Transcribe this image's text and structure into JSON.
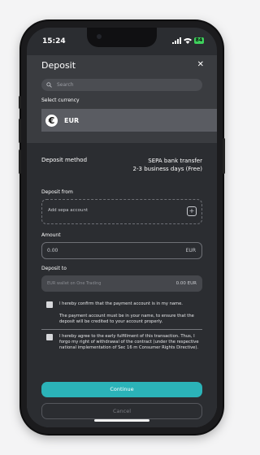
{
  "status": {
    "time": "15:24",
    "battery": "84"
  },
  "header": {
    "title": "Deposit",
    "close_label": "✕"
  },
  "search": {
    "placeholder": "Search"
  },
  "currency": {
    "section_label": "Select currency",
    "symbol": "€",
    "code": "EUR"
  },
  "method": {
    "label": "Deposit method",
    "value_line1": "SEPA bank transfer",
    "value_line2": "2-3 business days (Free)"
  },
  "deposit_from": {
    "label": "Deposit from",
    "placeholder": "Add sepa account"
  },
  "amount": {
    "label": "Amount",
    "value": "0.00",
    "unit": "EUR"
  },
  "deposit_to": {
    "label": "Deposit to",
    "placeholder": "EUR wallet on One Trading",
    "amount": "0.00 EUR"
  },
  "confirm": {
    "text1": "I hereby confirm that the payment account is in my name.",
    "note1": "The payment account must be in your name, to ensure that the deposit will be credited to your account properly.",
    "text2": "I hereby agree to the early fulfillment of this transaction. Thus, I forgo my right of withdrawal of the contract (under the respective national implementation of Sec 16 m Consumer Rights Directive)."
  },
  "actions": {
    "continue_label": "Continue",
    "cancel_label": "Cancel"
  },
  "colors": {
    "accent": "#2bb3b8",
    "sheet": "#3a3c40",
    "background": "#2b2d31"
  }
}
